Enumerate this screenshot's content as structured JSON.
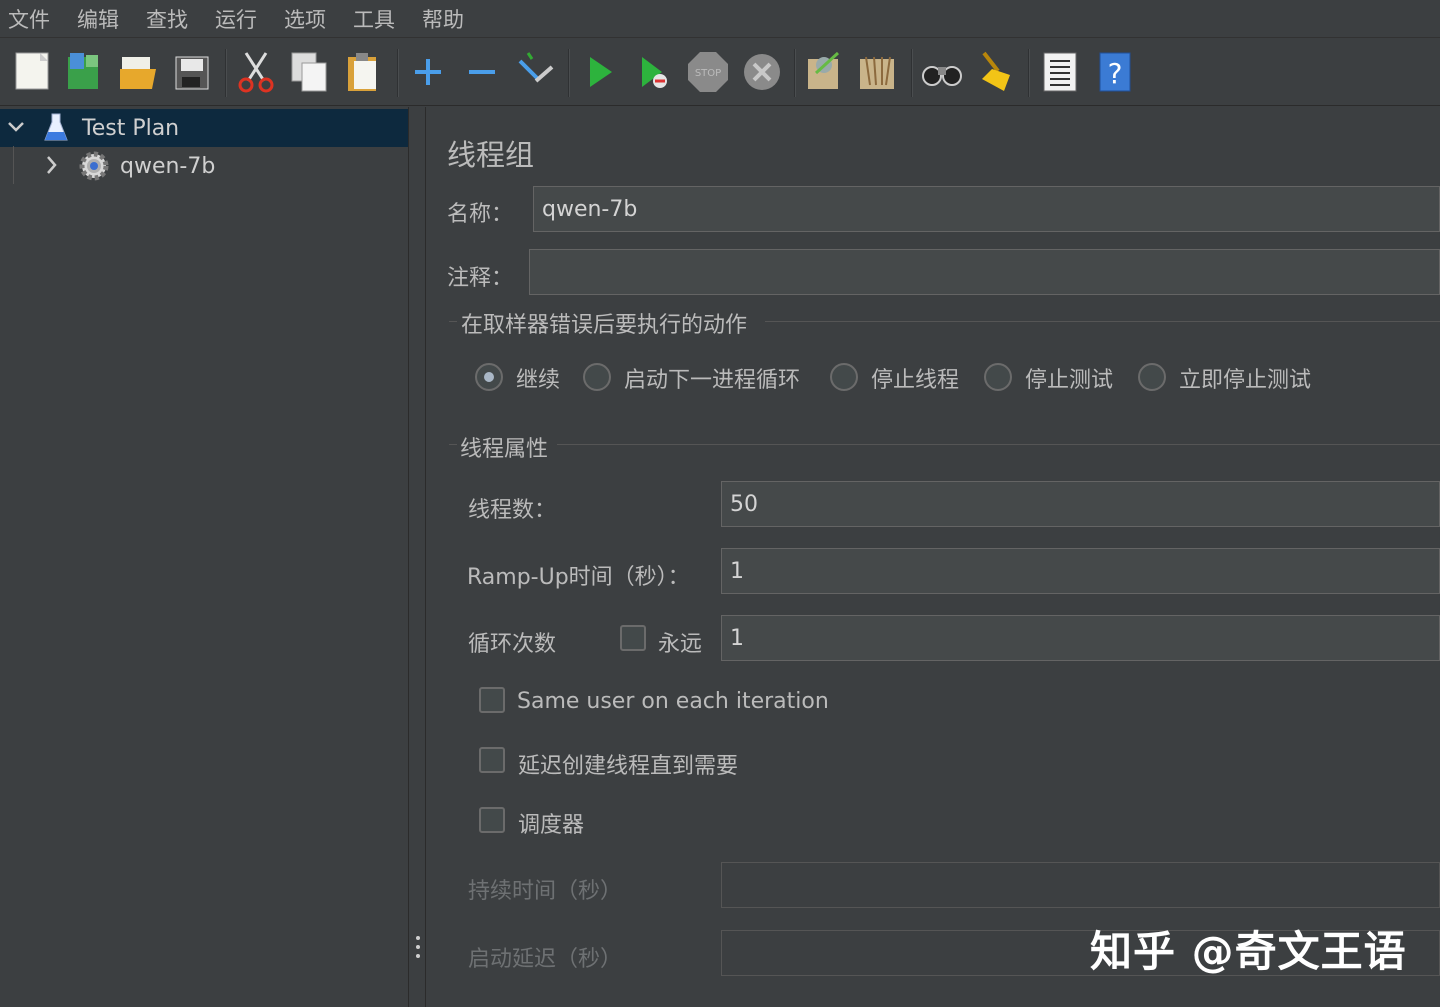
{
  "menu": [
    "文件",
    "编辑",
    "查找",
    "运行",
    "选项",
    "工具",
    "帮助"
  ],
  "toolbar": {
    "buttons": [
      "new-icon",
      "templates-icon",
      "open-icon",
      "save-icon",
      "cut-icon",
      "copy-icon",
      "paste-icon",
      "expand-icon",
      "collapse-icon",
      "toggle-icon",
      "start-icon",
      "start-no-pause-icon",
      "stop-icon",
      "shutdown-icon",
      "clear-icon",
      "clear-all-icon",
      "search-icon",
      "reset-search-icon",
      "function-helper-icon",
      "help-icon"
    ]
  },
  "tree": {
    "root_label": "Test Plan",
    "child_label": "qwen-7b"
  },
  "form": {
    "title": "线程组",
    "name_label": "名称：",
    "name_value": "qwen-7b",
    "comment_label": "注释：",
    "comment_value": "",
    "error_action_title": "在取样器错误后要执行的动作",
    "error_actions": [
      "继续",
      "启动下一进程循环",
      "停止线程",
      "停止测试",
      "立即停止测试"
    ],
    "error_action_selected": "继续",
    "thread_props_title": "线程属性",
    "threads_label": "线程数：",
    "threads_value": "50",
    "rampup_label": "Ramp-Up时间（秒）：",
    "rampup_value": "1",
    "loop_label": "循环次数",
    "forever_label": "永远",
    "loop_value": "1",
    "same_user_label": "Same user on each iteration",
    "delay_create_label": "延迟创建线程直到需要",
    "scheduler_label": "调度器",
    "duration_label": "持续时间（秒）",
    "startup_delay_label": "启动延迟（秒）"
  },
  "watermark": "知乎 @奇文王语"
}
